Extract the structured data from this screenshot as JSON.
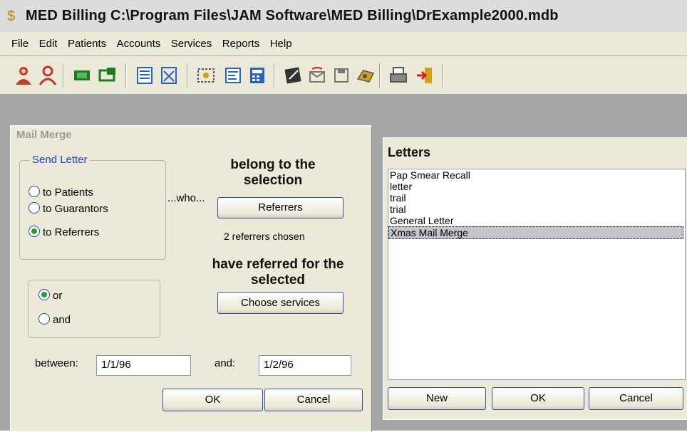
{
  "window": {
    "title": "MED Billing C:\\Program Files\\JAM Software\\MED Billing\\DrExample2000.mdb"
  },
  "menu": [
    "File",
    "Edit",
    "Patients",
    "Accounts",
    "Services",
    "Reports",
    "Help"
  ],
  "toolbar": {
    "buttons": [
      {
        "icon": "patient-icon",
        "color": "#c0392b"
      },
      {
        "icon": "patient-search-icon",
        "color": "#c0392b"
      },
      {
        "icon": "account-icon",
        "color": "#1e7a1e"
      },
      {
        "icon": "account-search-icon",
        "color": "#1e7a1e"
      },
      {
        "icon": "services-icon",
        "color": "#2463c7"
      },
      {
        "icon": "services-search-icon",
        "color": "#2463c7"
      },
      {
        "icon": "batch-icon",
        "color": "#555555"
      },
      {
        "icon": "report-icon",
        "color": "#2463c7"
      },
      {
        "icon": "calculator-icon",
        "color": "#2463c7"
      },
      {
        "icon": "notes-icon",
        "color": "#333333"
      },
      {
        "icon": "mail-icon",
        "color": "#777777"
      },
      {
        "icon": "save-icon",
        "color": "#777777"
      },
      {
        "icon": "tools-icon",
        "color": "#d4a017"
      },
      {
        "icon": "printer-icon",
        "color": "#555555"
      },
      {
        "icon": "exit-icon",
        "color": "#d62020"
      }
    ]
  },
  "mail_merge": {
    "caption": "Mail Merge",
    "send_letter": {
      "title": "Send Letter",
      "options": [
        {
          "label": "to Patients",
          "selected": false
        },
        {
          "label": "to Guarantors",
          "selected": false
        },
        {
          "label": "to Referrers",
          "selected": true
        }
      ]
    },
    "who_label": "...who...",
    "belong_text": "belong to the selection",
    "referrers_button": "Referrers",
    "referrers_status": "2 referrers chosen",
    "referred_text": "have referred for the selected",
    "choose_services_button": "Choose services",
    "logic": [
      {
        "label": "or",
        "selected": true
      },
      {
        "label": "and",
        "selected": false
      }
    ],
    "between_label": "between:",
    "between_value": "1/1/96",
    "and_label": "and:",
    "and_value": "1/2/96",
    "ok_button": "OK",
    "cancel_button": "Cancel"
  },
  "letters": {
    "title": "Letters",
    "items": [
      "Pap Smear  Recall",
      "letter",
      "trail",
      "trial",
      "General Letter",
      "Xmas Mail Merge"
    ],
    "selected_index": 5,
    "new_button": "New",
    "ok_button": "OK",
    "cancel_button": "Cancel"
  }
}
